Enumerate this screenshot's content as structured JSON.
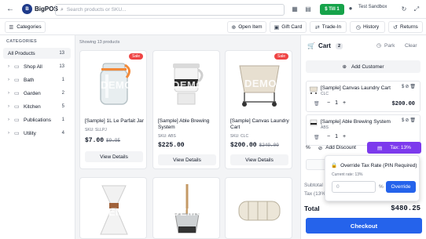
{
  "app": {
    "name": "BigPOS",
    "logo_text": "B"
  },
  "topbar": {
    "search_placeholder": "Search products or SKU...",
    "till_label": "$ Till 1",
    "user_label": "Test Sandbox"
  },
  "toolbar": {
    "categories_label": "Categories",
    "open_item": "Open Item",
    "gift_card": "Gift Card",
    "trade_in": "Trade-In",
    "history": "History",
    "returns": "Returns"
  },
  "sidebar": {
    "title": "CATEGORIES",
    "items": [
      {
        "label": "All Products",
        "count": "13",
        "active": true
      },
      {
        "label": "Shop All",
        "count": "13"
      },
      {
        "label": "Bath",
        "count": "1"
      },
      {
        "label": "Garden",
        "count": "2"
      },
      {
        "label": "Kitchen",
        "count": "5"
      },
      {
        "label": "Publications",
        "count": "1"
      },
      {
        "label": "Utility",
        "count": "4"
      }
    ]
  },
  "products": {
    "showing": "Showing 13 products",
    "details_label": "View Details",
    "sale_label": "Sale",
    "demo_label": "DEMO",
    "items": [
      {
        "name": "[Sample] 1L Le Parfait Jar",
        "sku": "SKU: SLLPJ",
        "price": "$7.00",
        "old_price": "$9.95",
        "sale": true
      },
      {
        "name": "[Sample] Able Brewing System",
        "sku": "SKU: ABS",
        "price": "$225.00",
        "old_price": "",
        "sale": false
      },
      {
        "name": "[Sample] Canvas Laundry Cart",
        "sku": "SKU: CLC",
        "price": "$200.00",
        "old_price": "$249.00",
        "sale": true
      }
    ]
  },
  "cart": {
    "title": "Cart",
    "count": "2",
    "park": "Park",
    "clear": "Clear",
    "add_customer": "Add Customer",
    "items": [
      {
        "name": "[Sample] Canvas Laundry Cart",
        "sku": "CLC",
        "qty": "1",
        "price": "$200.00"
      },
      {
        "name": "[Sample] Able Brewing System",
        "sku": "ABS",
        "qty": "1",
        "price": "$225.00"
      }
    ],
    "add_discount": "Add Discount",
    "tax_label": "Tax: 13%",
    "subtotal_label": "Subtotal",
    "tax_line_label": "Tax (13%)",
    "total_label": "Total",
    "total_value": "$480.25",
    "checkout": "Checkout"
  },
  "popup": {
    "title": "Override Tax Rate (PIN Required)",
    "current_rate": "Current rate: 13%",
    "input_placeholder": "0",
    "percent": "%",
    "override_button": "Override"
  }
}
